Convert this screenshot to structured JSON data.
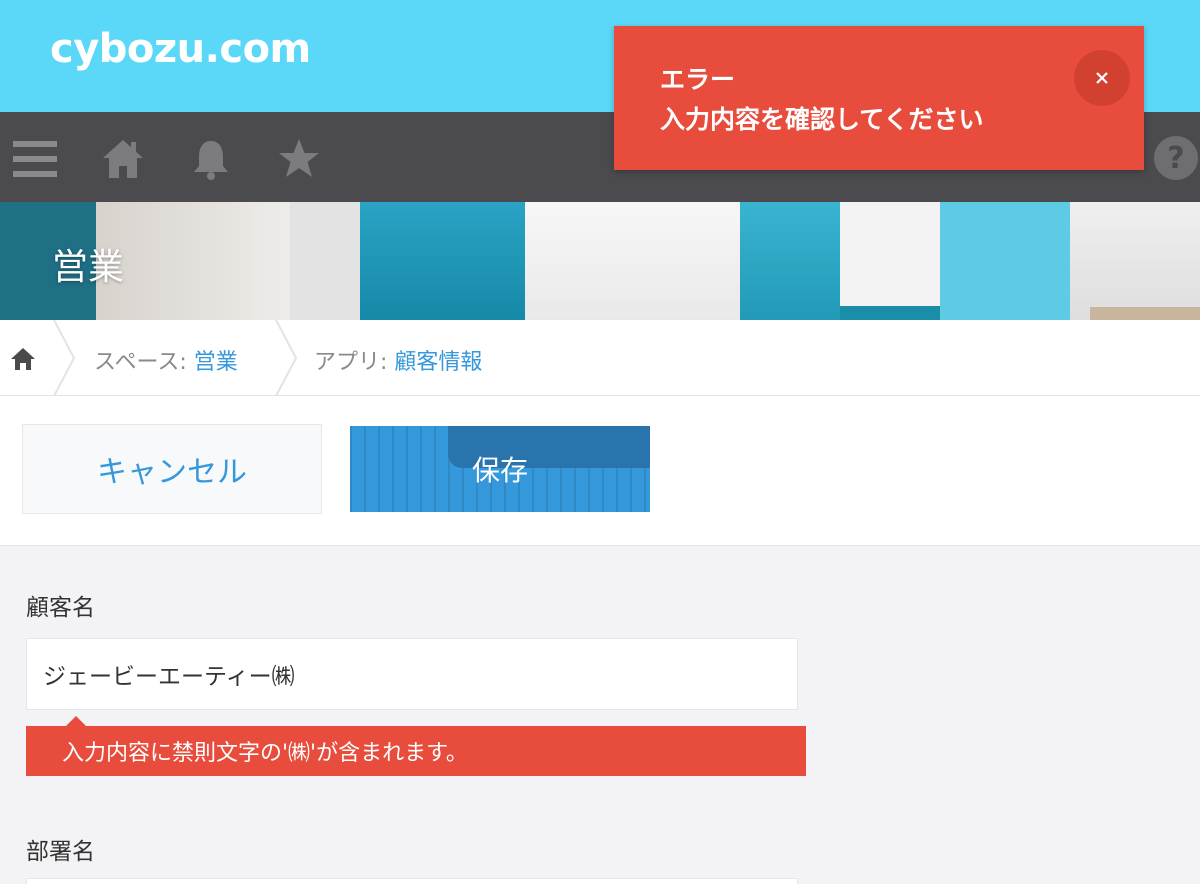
{
  "header": {
    "logo": "cybozu.com"
  },
  "navbar": {
    "icons": [
      "menu-icon",
      "home-icon",
      "bell-icon",
      "star-icon",
      "help-icon"
    ]
  },
  "notification": {
    "title": "エラー",
    "message": "入力内容を確認してください",
    "close": "×",
    "color": "#e74c3c"
  },
  "banner": {
    "title": "営業"
  },
  "breadcrumb": {
    "space_prefix": "スペース: ",
    "space_name": "営業",
    "app_prefix": "アプリ: ",
    "app_name": "顧客情報"
  },
  "actions": {
    "cancel_label": "キャンセル",
    "save_label": "保存"
  },
  "form": {
    "customer_name_label": "顧客名",
    "customer_name_value": "ジェービーエーティー㈱",
    "customer_name_error": "入力内容に禁則文字の'㈱'が含まれます。",
    "department_label": "部署名"
  },
  "colors": {
    "header": "#5bd8f8",
    "navbar": "#4b4a4e",
    "accent": "#3498db",
    "error": "#e74c3c"
  }
}
